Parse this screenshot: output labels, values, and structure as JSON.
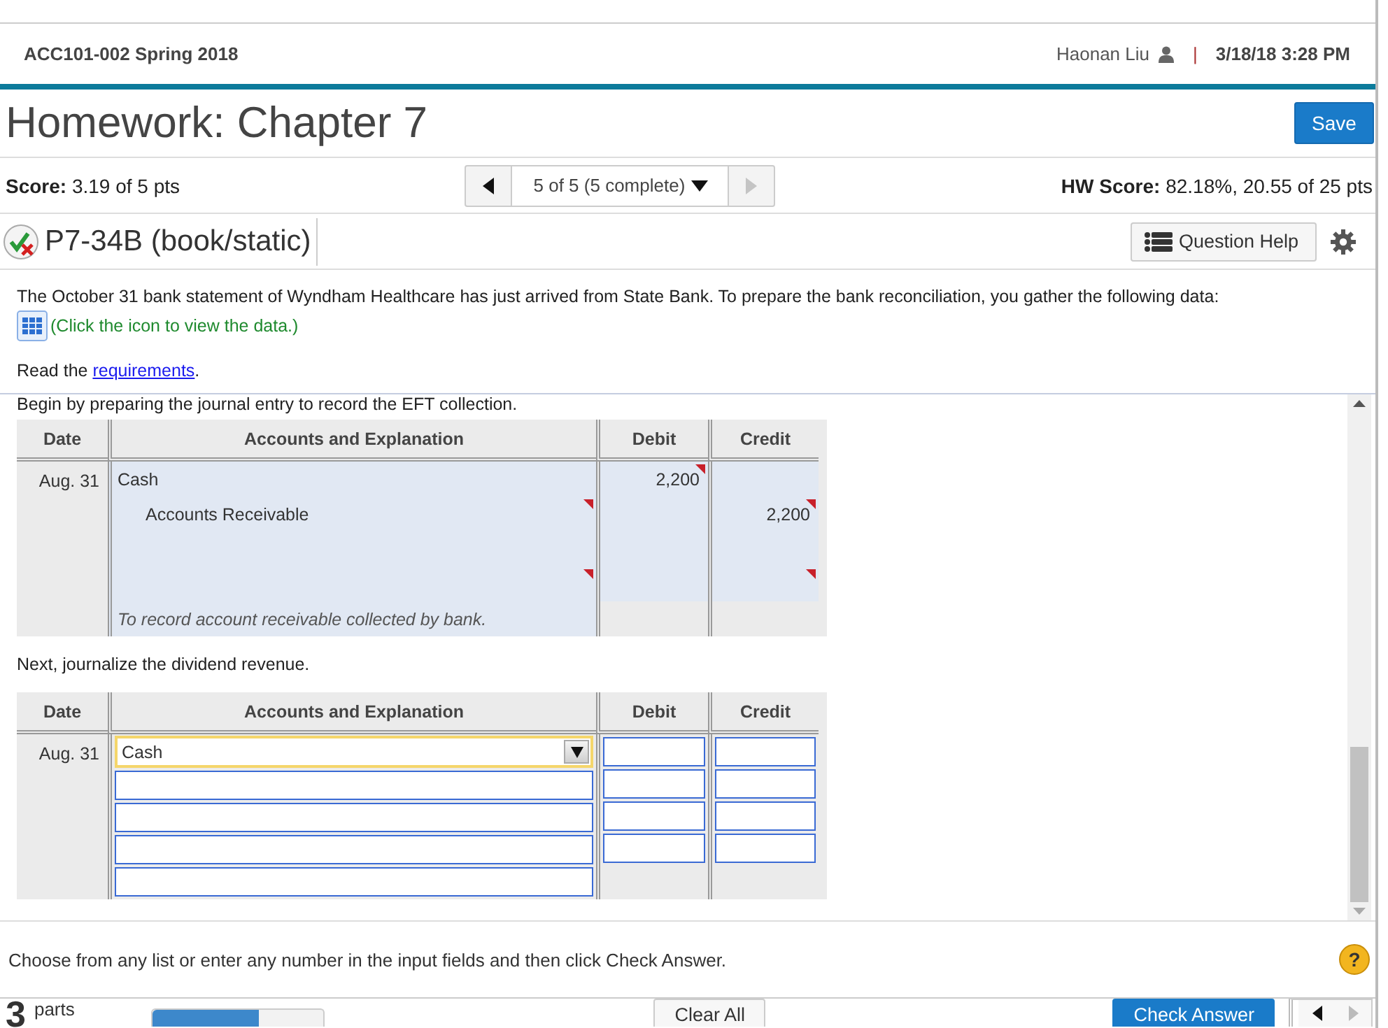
{
  "header": {
    "course": "ACC101-002 Spring 2018",
    "user": "Haonan Liu",
    "separator": "|",
    "datetime": "3/18/18 3:28 PM"
  },
  "title": "Homework: Chapter 7",
  "save_button": "Save",
  "score": {
    "label": "Score:",
    "value": "3.19 of 5 pts"
  },
  "navigator": {
    "position": "5 of 5 (5 complete)",
    "prev_disabled": false,
    "next_disabled": true
  },
  "hw_score": {
    "label": "HW Score:",
    "value": "82.18%, 20.55 of 25 pts"
  },
  "question": {
    "name": "P7-34B (book/static)",
    "help_button": "Question Help"
  },
  "intro": "The October 31 bank statement of Wyndham Healthcare has just arrived from State Bank. To prepare the bank reconciliation, you gather the following data:",
  "data_link": "(Click the icon to view the data.)",
  "requirements": {
    "text": "Read the ",
    "link": "requirements",
    "end": "."
  },
  "part1": {
    "instruction": "Begin by preparing the journal entry to record the EFT collection.",
    "columns": [
      "Date",
      "Accounts and Explanation",
      "Debit",
      "Credit"
    ],
    "date": "Aug. 31",
    "lines": [
      {
        "kind": "debit",
        "account": {
          "text": "Cash"
        },
        "debit": {
          "text": "2,200",
          "flagged": true
        }
      },
      {
        "kind": "credit",
        "account": {
          "text": "Accounts Receivable",
          "flagged": true
        },
        "credit": {
          "text": "2,200",
          "flagged": true
        }
      },
      {
        "kind": "blank"
      },
      {
        "kind": "blank",
        "account": {
          "flagged": true
        },
        "credit": {
          "flagged": true
        }
      }
    ],
    "explanation": "To record account receivable collected by bank."
  },
  "part2": {
    "instruction": "Next, journalize the dividend revenue.",
    "columns": [
      "Date",
      "Accounts and Explanation",
      "Debit",
      "Credit"
    ],
    "date": "Aug. 31",
    "rows": [
      {
        "kind": "select",
        "value": "Cash",
        "focused": true,
        "amounts": true
      },
      {
        "kind": "input",
        "focused": false,
        "amounts": true
      },
      {
        "kind": "input",
        "focused": false,
        "amounts": true
      },
      {
        "kind": "input",
        "focused": false,
        "amounts": true
      },
      {
        "kind": "input",
        "focused": false,
        "amounts": false
      }
    ]
  },
  "footer": {
    "instruction": "Choose from any list or enter any number in the input fields and then click Check Answer.",
    "help": "?"
  },
  "bottom": {
    "parts_count": "3",
    "parts_label": "parts",
    "progress": {
      "level": 0.62
    },
    "clear_button": "Clear All",
    "check_button": "Check Answer"
  }
}
